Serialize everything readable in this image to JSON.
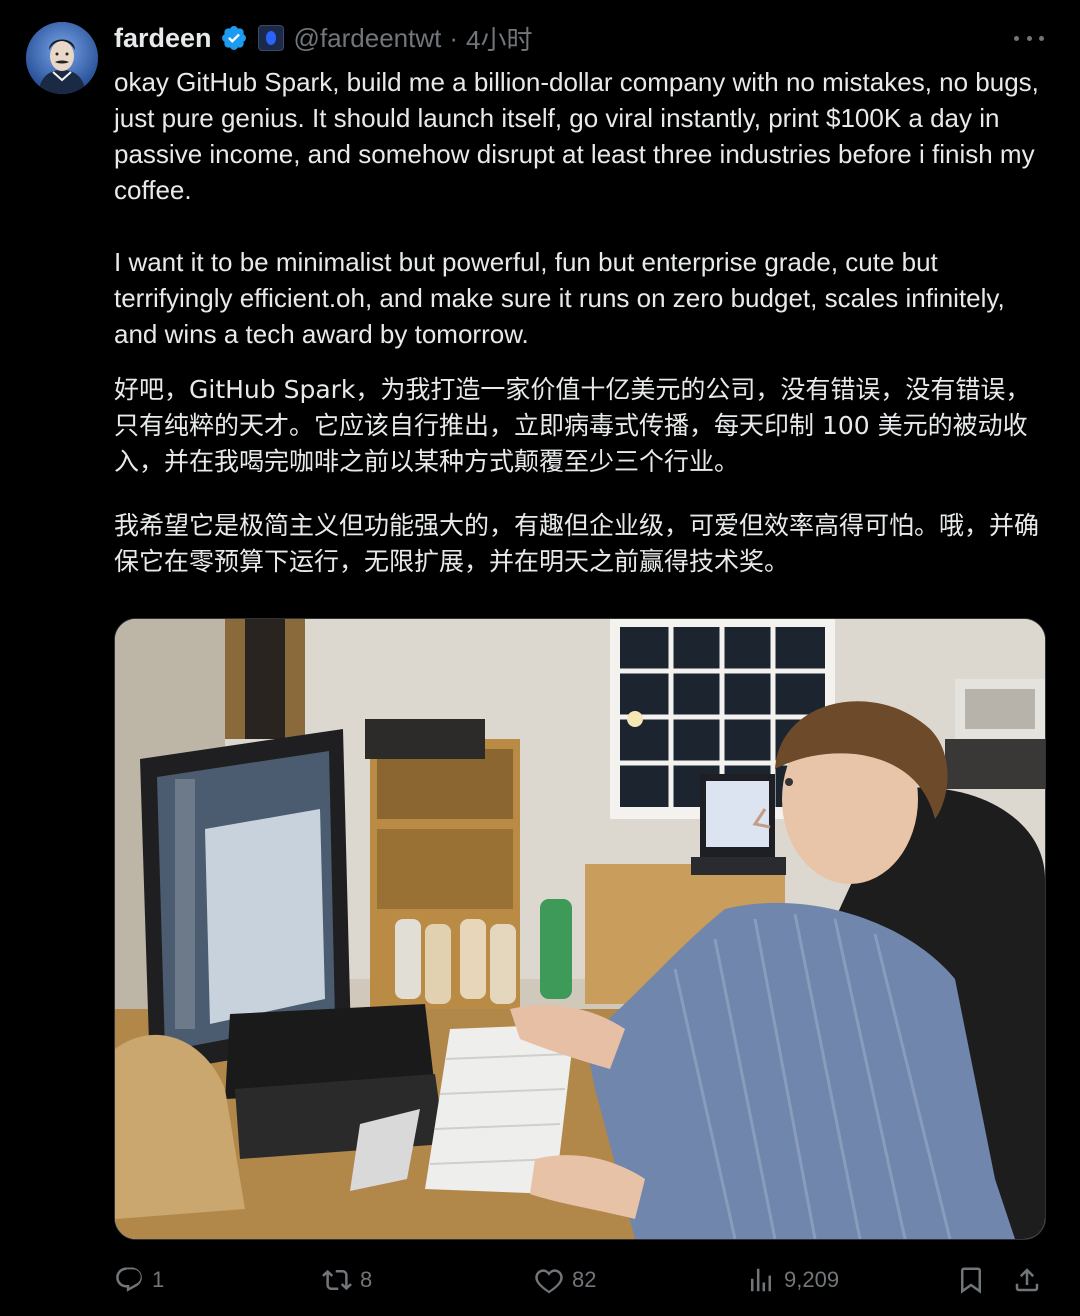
{
  "author": {
    "display_name": "fardeen",
    "handle": "@fardeentwt",
    "separator": "·",
    "timestamp": "4小时",
    "verified_icon": "verified-badge-icon",
    "affiliation_icon": "affiliation-badge-icon"
  },
  "tweet": {
    "en_paragraph_1": "okay GitHub Spark, build me a billion-dollar company with no mistakes, no bugs, just pure genius. It should launch itself, go viral instantly, print $100K a day in passive income, and somehow disrupt at least three industries before i finish my coffee.",
    "en_paragraph_2": "I want it to be minimalist but powerful, fun but enterprise grade, cute but terrifyingly efficient.oh, and make sure it runs on zero budget, scales infinitely, and wins a tech award by tomorrow.",
    "zh_paragraph_1": "好吧，GitHub Spark，为我打造一家价值十亿美元的公司，没有错误，没有错误，只有纯粹的天才。它应该自行推出，立即病毒式传播，每天印制 100 美元的被动收入，并在我喝完咖啡之前以某种方式颠覆至少三个行业。",
    "zh_paragraph_2": "我希望它是极简主义但功能强大的，有趣但企业级，可爱但效率高得可怕。哦，并确保它在零预算下运行，无限扩展，并在明天之前赢得技术奖。"
  },
  "media": {
    "icon": "photo-media"
  },
  "actions": {
    "reply_count": "1",
    "retweet_count": "8",
    "like_count": "82",
    "views_count": "9,209"
  },
  "colors": {
    "background": "#000000",
    "primary_text": "#e7e9ea",
    "secondary_text": "#71767b",
    "verified_blue": "#1d9bf0"
  }
}
